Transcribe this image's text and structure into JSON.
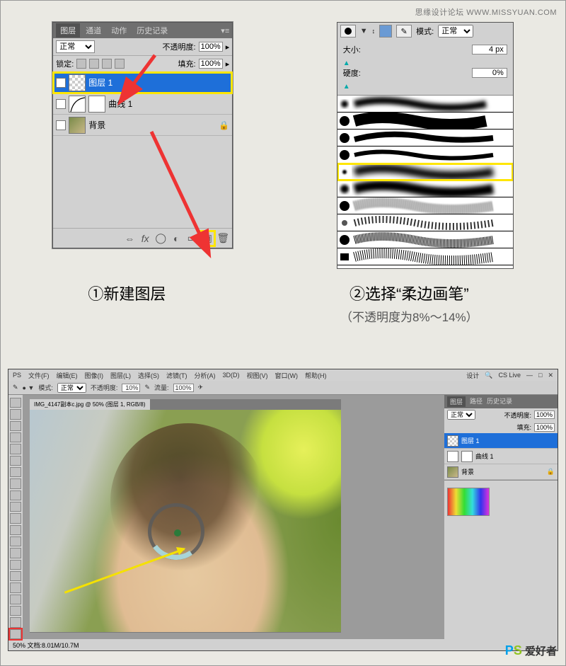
{
  "watermark_top": "思缘设计论坛   WWW.MISSYUAN.COM",
  "watermark_bottom": {
    "p": "P",
    "s": "S",
    "txt": " 爱好者"
  },
  "layers_panel": {
    "tabs": [
      "图层",
      "通道",
      "动作",
      "历史记录"
    ],
    "blend_mode": "正常",
    "opacity_label": "不透明度:",
    "opacity_value": "100%",
    "lock_label": "锁定:",
    "fill_label": "填充:",
    "fill_value": "100%",
    "layer1": "图层 1",
    "curves": "曲线 1",
    "background": "背景"
  },
  "brush_panel": {
    "mode_label": "模式:",
    "mode_value": "正常",
    "size_label": "大小:",
    "size_value": "4 px",
    "hardness_label": "硬度:",
    "hardness_value": "0%"
  },
  "captions": {
    "c1": "①新建图层",
    "c2_main": "②选择“柔边画笔”",
    "c2_sub": "（不透明度为8%～14%）"
  },
  "ps_window": {
    "menu": [
      "PS",
      "文件(F)",
      "编辑(E)",
      "图像(I)",
      "图层(L)",
      "选择(S)",
      "滤镜(T)",
      "分析(A)",
      "3D(D)",
      "视图(V)",
      "窗口(W)",
      "帮助(H)"
    ],
    "menu_right": [
      "设计",
      "CS Live"
    ],
    "optbar_mode_label": "模式:",
    "optbar_mode_value": "正常",
    "optbar_opacity_label": "不透明度:",
    "optbar_opacity_value": "10%",
    "optbar_flow_label": "流量:",
    "optbar_flow_value": "100%",
    "doc_tab": "IMG_4147副本c.jpg @ 50% (图层 1, RGB/8)",
    "status": "50%     文档:8.01M/10.7M",
    "sp_tabs": [
      "图层",
      "路径",
      "历史记录"
    ],
    "sp_mode": "正常",
    "sp_opac_label": "不透明度:",
    "sp_opac_value": "100%",
    "sp_fill_label": "填充:",
    "sp_fill_value": "100%",
    "sp_l1": "图层 1",
    "sp_l2": "曲线 1",
    "sp_l3": "背景"
  }
}
